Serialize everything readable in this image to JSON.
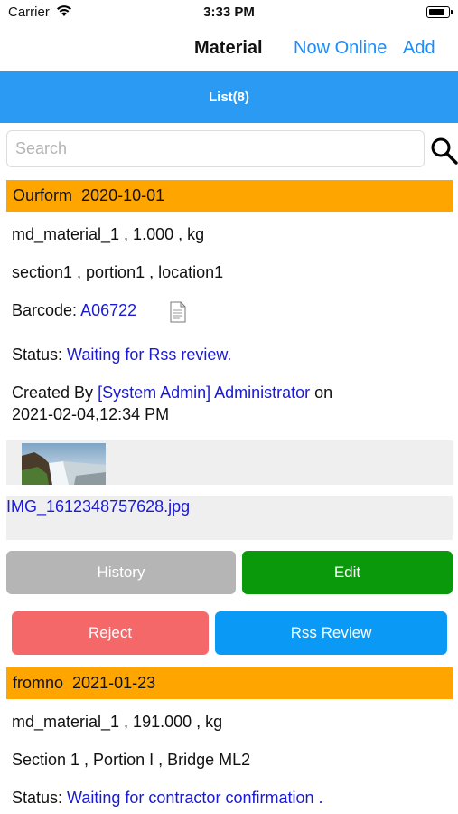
{
  "status_bar": {
    "carrier": "Carrier",
    "time": "3:33 PM",
    "battery_level": 0.9
  },
  "nav": {
    "title": "Material",
    "online_label": "Now Online",
    "add_label": "Add"
  },
  "tabs": [
    {
      "label": "List(8)"
    }
  ],
  "search": {
    "placeholder": "Search",
    "value": ""
  },
  "items": [
    {
      "form": "Ourform",
      "date": "2020-10-01",
      "material": "md_material_1 , 1.000 , kg",
      "location": "section1 , portion1 , location1",
      "barcode_label": "Barcode:",
      "barcode": "A06722",
      "status_label": "Status:",
      "status": "Waiting for Rss review.",
      "created_by_label": "Created By",
      "created_by": "[System Admin] Administrator",
      "created_on_label": "on",
      "created_at": "2021-02-04,12:34 PM",
      "image_file": "IMG_1612348757628.jpg",
      "actions": {
        "history": "History",
        "edit": "Edit",
        "reject": "Reject",
        "rss_review": "Rss Review"
      }
    },
    {
      "form": "fromno",
      "date": "2021-01-23",
      "material": "md_material_1 , 191.000 , kg",
      "location": "Section 1 , Portion I , Bridge ML2",
      "status_label": "Status:",
      "status": "Waiting for contractor confirmation ."
    }
  ],
  "colors": {
    "accent": "#2b9af3",
    "link": "#1a8cff",
    "header_bar": "#ffa500",
    "history": "#b5b5b5",
    "edit": "#0a990a",
    "reject": "#f4686a",
    "rss_review": "#0a9af5"
  }
}
